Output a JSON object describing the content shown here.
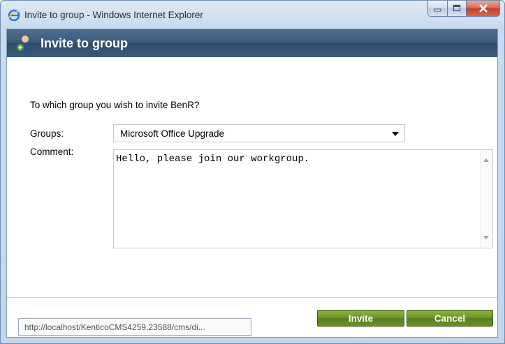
{
  "window": {
    "title": "Invite to group - Windows Internet Explorer"
  },
  "dialog": {
    "title": "Invite to group",
    "question": "To which group you wish to invite BenR?",
    "groups_label": "Groups:",
    "groups_selected": "Microsoft Office Upgrade",
    "comment_label": "Comment:",
    "comment_value": "Hello, please join our workgroup.",
    "invite_label": "Invite",
    "cancel_label": "Cancel"
  },
  "status": {
    "url": "http://localhost/KenticoCMS4259.23588/cms/di..."
  },
  "icons": {
    "browser": "ie-icon",
    "header": "user-group-icon",
    "dropdown": "chevron-down-icon"
  },
  "colors": {
    "header_bg": "#3a5877",
    "button_green": "#6b9129",
    "window_frame": "#c9daee"
  }
}
